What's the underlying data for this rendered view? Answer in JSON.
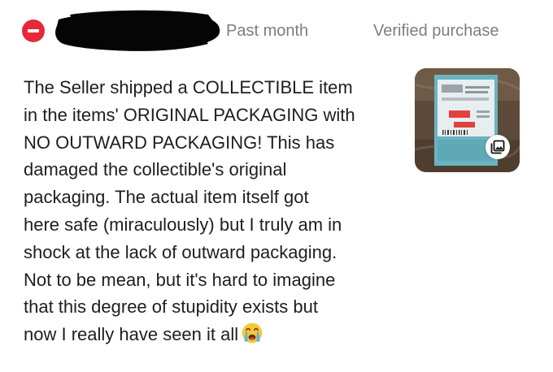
{
  "review": {
    "rating_icon": "negative-minus-icon",
    "date": "Past month",
    "badge": "Verified purchase",
    "text_lines": [
      "The Seller shipped a COLLECTIBLE item",
      "in the items' ORIGINAL PACKAGING with",
      "NO OUTWARD PACKAGING! This has",
      "damaged the collectible's original",
      "packaging. The actual item itself got",
      "here safe (miraculously) but I truly am in",
      "shock at the lack of outward packaging.",
      "Not to be mean, but it's hard to imagine",
      "that this degree of stupidity exists but",
      "now I really have seen it all"
    ],
    "emoji": "crying-face-emoji",
    "photo_icon": "image-gallery-icon"
  },
  "colors": {
    "negative": "#e8273a",
    "meta_text": "#7d7d7d",
    "body_text": "#1e1e1e"
  }
}
